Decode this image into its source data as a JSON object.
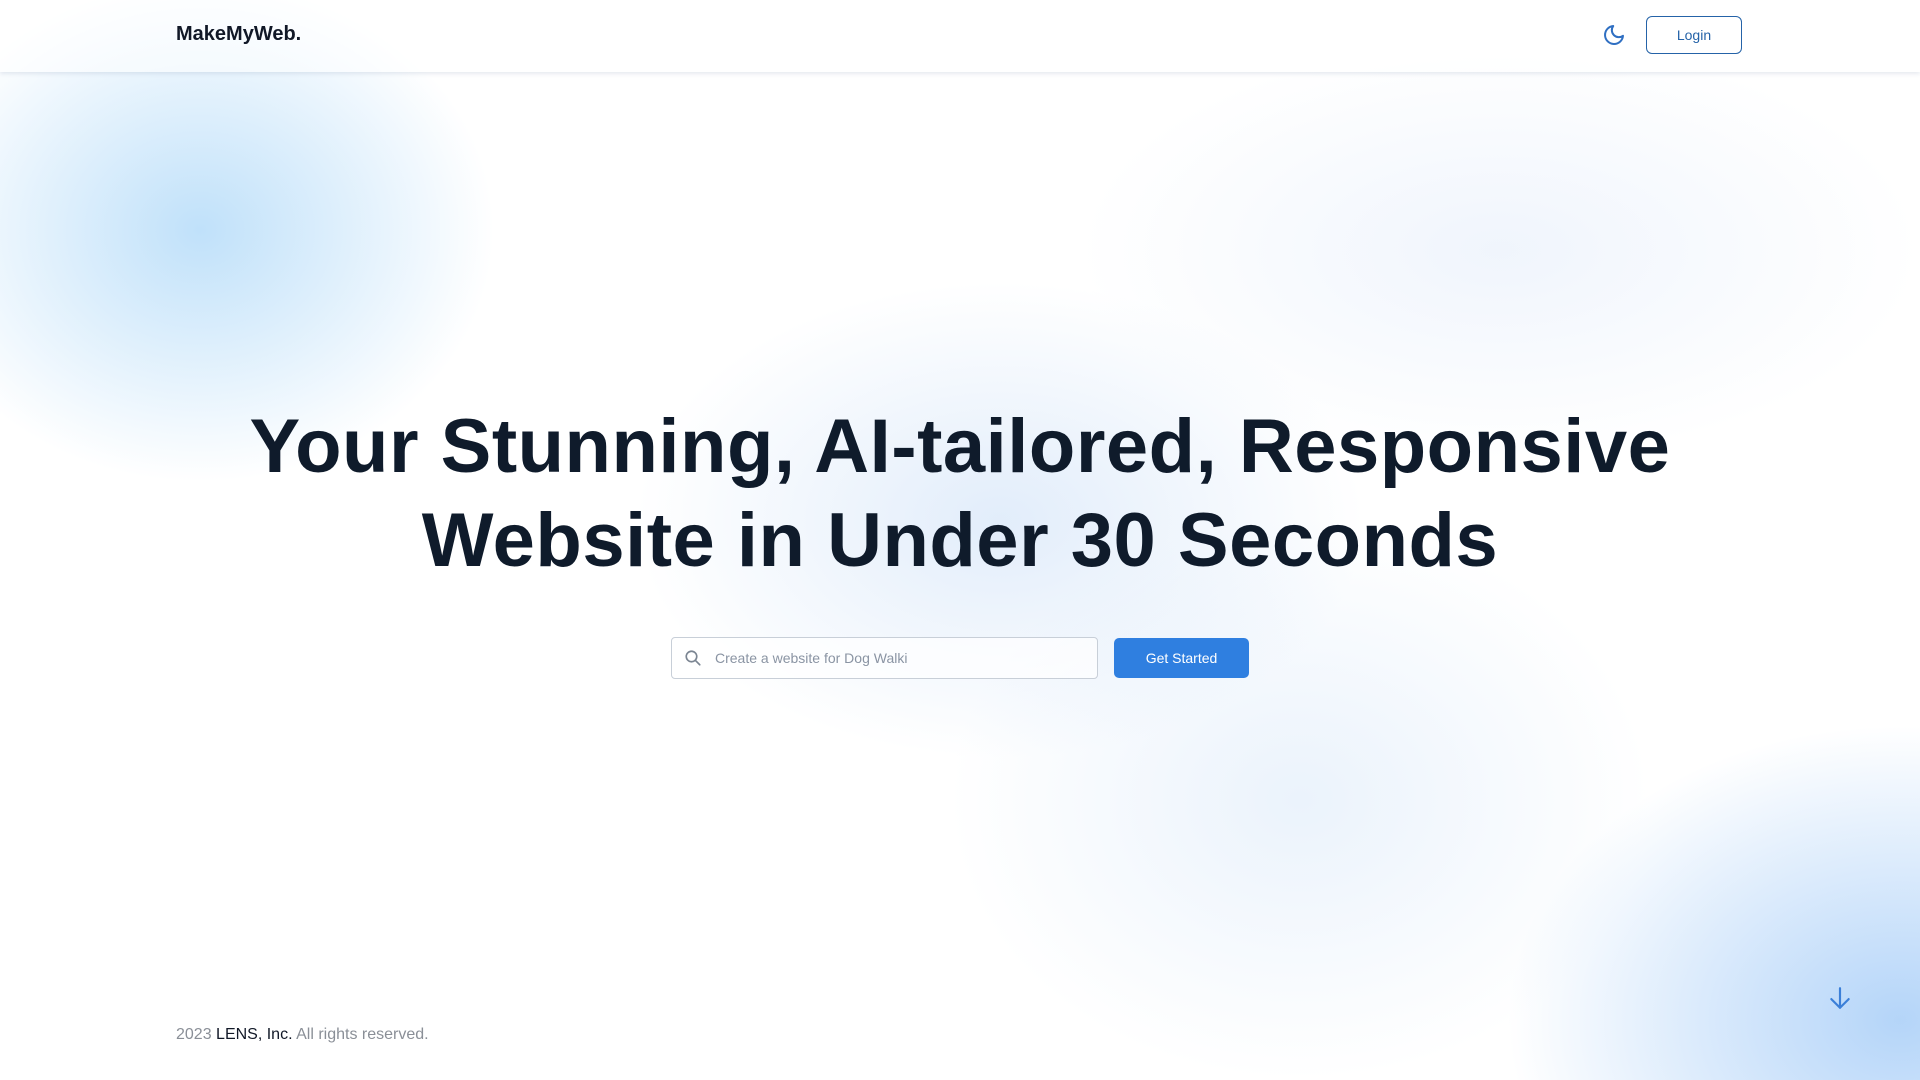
{
  "header": {
    "brand": "MakeMyWeb.",
    "theme_toggle_icon": "moon-icon",
    "login_label": "Login"
  },
  "hero": {
    "title_line1": "Your Stunning, AI-tailored, Responsive",
    "title_line2": "Website in Under 30 Seconds",
    "search": {
      "icon": "search-icon",
      "value": "",
      "placeholder": "Create a website for Dog Walki"
    },
    "cta_label": "Get Started"
  },
  "footer": {
    "year": "2023",
    "company": "LENS, Inc.",
    "rights": "All rights reserved."
  },
  "scroll_icon": "arrow-down-icon",
  "colors": {
    "accent": "#2f7fe0",
    "login_border": "#2563a8",
    "heading": "#0f1b2b"
  }
}
